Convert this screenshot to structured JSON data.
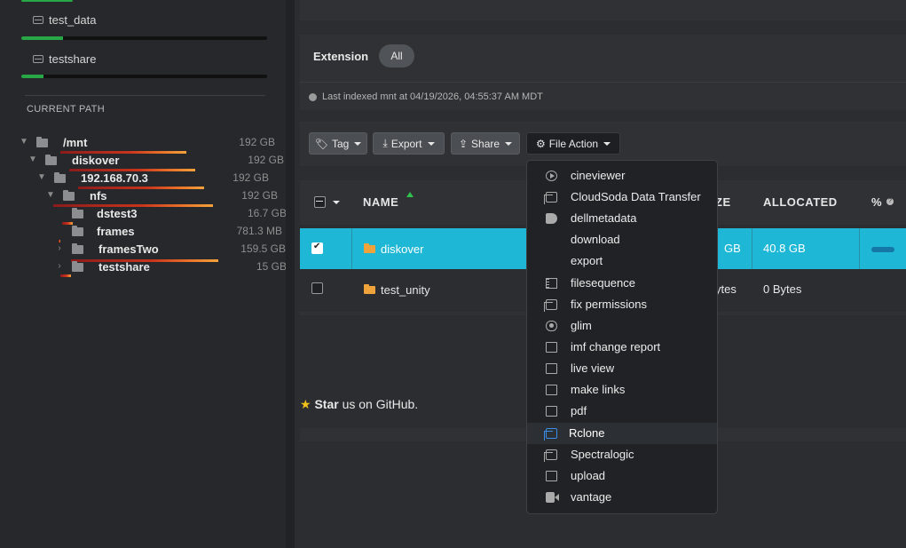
{
  "sidebar": {
    "disks": [
      {
        "name": "test_data",
        "usage_fraction": 0.17
      },
      {
        "name": "testshare",
        "usage_fraction": 0.09
      }
    ],
    "current_path_label": "CURRENT PATH",
    "tree": [
      {
        "name": "/mnt",
        "size": "192 GB"
      },
      {
        "name": "diskover",
        "size": "192 GB"
      },
      {
        "name": "192.168.70.3",
        "size": "192 GB"
      },
      {
        "name": "nfs",
        "size": "192 GB"
      },
      {
        "name": "dstest3",
        "size": "16.7 GB"
      },
      {
        "name": "frames",
        "size": "781.3 MB"
      },
      {
        "name": "framesTwo",
        "size": "159.5 GB"
      },
      {
        "name": "testshare",
        "size": "15 GB"
      }
    ]
  },
  "filters": {
    "extension_label": "Extension",
    "extension_value": "All",
    "indexed_text": "Last indexed mnt at 04/19/2026, 04:55:37 AM MDT"
  },
  "toolbar": {
    "tag": "Tag",
    "export": "Export",
    "share": "Share",
    "file_action": "File Action"
  },
  "table": {
    "headers": {
      "name": "NAME",
      "size": "ZE",
      "allocated": "ALLOCATED",
      "percent": "%"
    },
    "rows": [
      {
        "name": "diskover",
        "size": "GB",
        "allocated": "40.8 GB",
        "selected": true
      },
      {
        "name": "test_unity",
        "size": "ytes",
        "allocated": "0 Bytes",
        "selected": false
      }
    ]
  },
  "footer": {
    "star": "Star",
    "rest": " us on GitHub."
  },
  "menu": {
    "items": [
      {
        "label": "cineviewer",
        "icon": "play-circle-icon"
      },
      {
        "label": "CloudSoda Data Transfer",
        "icon": "copy-icon"
      },
      {
        "label": "dellmetadata",
        "icon": "tags-icon"
      },
      {
        "label": "download",
        "icon": ""
      },
      {
        "label": "export",
        "icon": ""
      },
      {
        "label": "filesequence",
        "icon": "film-icon"
      },
      {
        "label": "fix permissions",
        "icon": "copy-icon"
      },
      {
        "label": "glim",
        "icon": "eye-icon"
      },
      {
        "label": "imf change report",
        "icon": "folder-open-icon"
      },
      {
        "label": "live view",
        "icon": "folder-open-icon"
      },
      {
        "label": "make links",
        "icon": "folder-open-icon"
      },
      {
        "label": "pdf",
        "icon": "folder-open-icon"
      },
      {
        "label": "Rclone",
        "icon": "copy-icon"
      },
      {
        "label": "Spectralogic",
        "icon": "copy-icon"
      },
      {
        "label": "upload",
        "icon": "folder-open-icon"
      },
      {
        "label": "vantage",
        "icon": "video-camera-icon"
      }
    ],
    "highlighted": "Rclone"
  },
  "colors": {
    "accent": "#1fb7d6",
    "bar_green": "#27a745",
    "folder": "#f0a33a"
  }
}
